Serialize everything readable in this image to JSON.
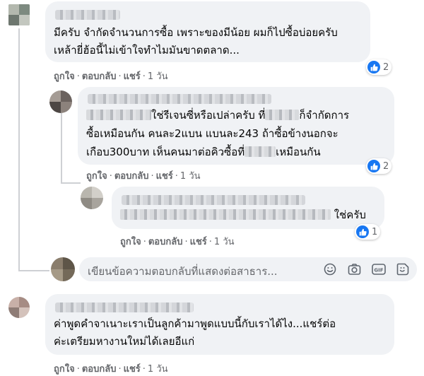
{
  "comments": [
    {
      "text_lines": [
        "มีครับ จำกัดจำนวนการซื้อ เพราะของมีน้อย ผมก็ไปซื้อบ่อยครับ",
        "เหล้ายี่ฮ้อนี้ไม่เข้าใจทำไมมันขาดตลาด..."
      ],
      "actions": {
        "like": "ถูกใจ",
        "reply": "ตอบกลับ",
        "share": "แชร์",
        "time": "1 วัน"
      },
      "reactions": "2"
    },
    {
      "line1_after": "ใช่รีเจนซี่หรือเปล่าครับ ที่",
      "line1_end": "ก็จำกัดการ",
      "line2": "ซื้อเหมือนกัน คนละ2แบน แบนละ243 ถ้าซื้อข้างนอกจะ",
      "line3_start": "เกือบ300บาท เห็นคนมาต่อคิวซื้อที่",
      "line3_end": "เหมือนกัน",
      "actions": {
        "like": "ถูกใจ",
        "reply": "ตอบกลับ",
        "share": "แชร์",
        "time": "1 วัน"
      },
      "reactions": "2"
    },
    {
      "text_end": "ใช่ครับ",
      "actions": {
        "like": "ถูกใจ",
        "reply": "ตอบกลับ",
        "share": "แชร์",
        "time": "1 วัน"
      },
      "reactions": "1"
    },
    {
      "text_lines": [
        "ค่าพูดคำจาเนาะเราเป็นลูกค้ามาพูดแบบนี้กับเราได้ไง...แชร์ต่อ",
        "ค่ะเตรียมหางานใหม่ได้เลยอีแก่"
      ],
      "actions": {
        "like": "ถูกใจ",
        "reply": "ตอบกลับ",
        "share": "แชร์",
        "time": "1 วัน"
      }
    }
  ],
  "reply_box": {
    "placeholder": "เขียนข้อความตอบกลับที่แสดงต่อสาธาร..."
  },
  "icons": [
    "emoji-icon",
    "camera-icon",
    "gif-icon",
    "sticker-icon",
    "like-icon"
  ],
  "colors": {
    "bubble": "#f0f2f5",
    "like_blue": "#1877f2",
    "meta_gray": "#65676b"
  }
}
